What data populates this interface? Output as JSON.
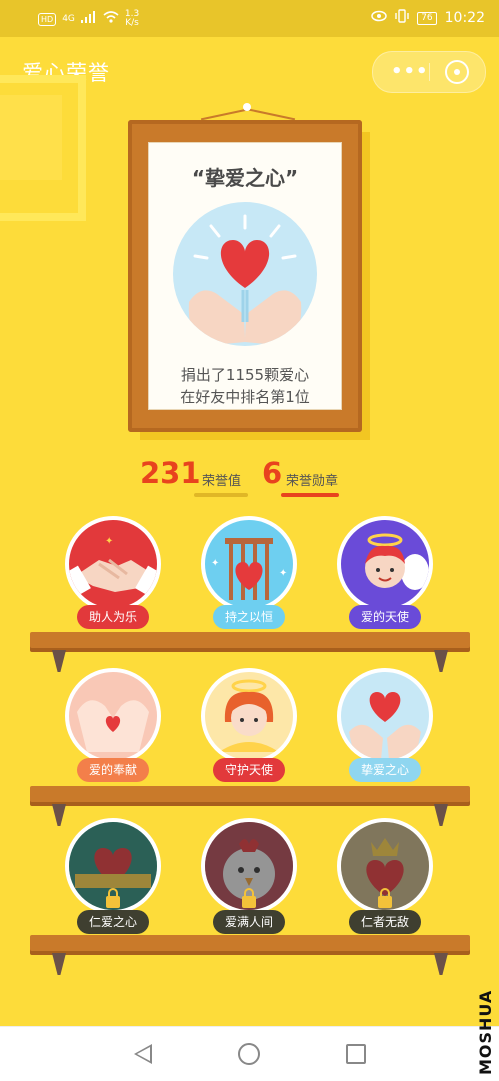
{
  "status_bar": {
    "hd": "HD",
    "network": "4G",
    "speed": "1.3",
    "speed_unit": "K/s",
    "battery": "76",
    "time": "10:22"
  },
  "header": {
    "title": "爱心荣誉",
    "more_label": "•••"
  },
  "frame": {
    "title": "“挚爱之心”",
    "line1": "捐出了1155颗爱心",
    "line2": "在好友中排名第1位"
  },
  "stats": {
    "honor_value": "231",
    "honor_label": "荣誉值",
    "medals_value": "6",
    "medals_label": "荣誉勋章"
  },
  "badges": [
    {
      "label": "助人为乐",
      "locked": false,
      "color": "#e2393b"
    },
    {
      "label": "持之以恒",
      "locked": false,
      "color": "#6ecff0"
    },
    {
      "label": "爱的天使",
      "locked": false,
      "color": "#6a4bd8"
    },
    {
      "label": "爱的奉献",
      "locked": false,
      "color": "#f37f4a"
    },
    {
      "label": "守护天使",
      "locked": false,
      "color": "#e2393b"
    },
    {
      "label": "挚爱之心",
      "locked": false,
      "color": "#8fd6f0"
    },
    {
      "label": "仁爱之心",
      "locked": true,
      "color": "#3f3f30"
    },
    {
      "label": "爱满人间",
      "locked": true,
      "color": "#3f3f30"
    },
    {
      "label": "仁者无敌",
      "locked": true,
      "color": "#3f3f30"
    }
  ],
  "watermark": "MOSHUA",
  "colors": {
    "background": "#fddc3a",
    "accent": "#e8431e",
    "wood": "#c97a2a"
  }
}
